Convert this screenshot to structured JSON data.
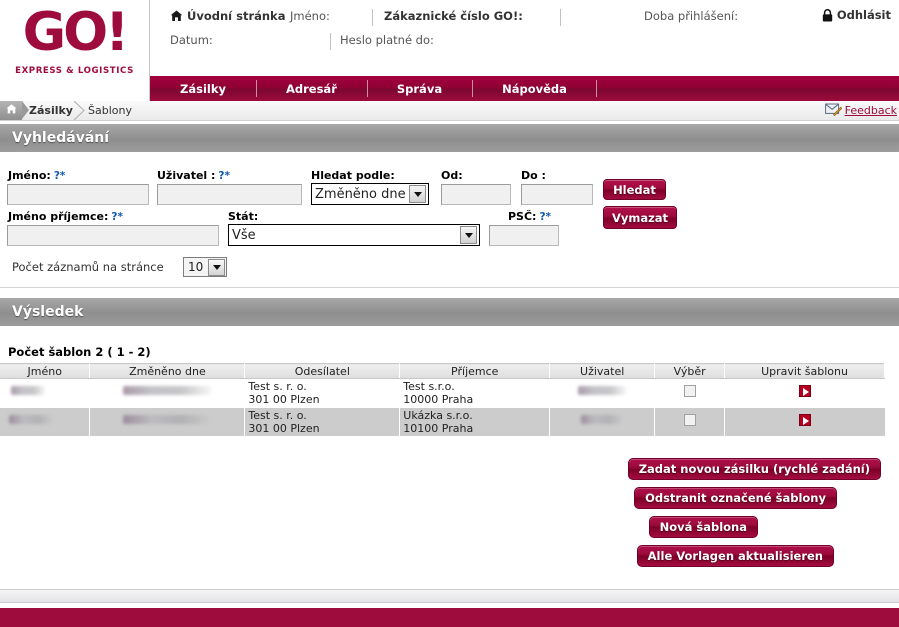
{
  "brand": {
    "logo_text": "GO!",
    "logo_sub": "EXPRESS & LOGISTICS",
    "accent_color": "#9e0b3d",
    "band_color": "#8e8e8e"
  },
  "header": {
    "home_link": "Úvodní stránka",
    "home_icon": "home-icon",
    "fields": [
      {
        "label": "Jméno:",
        "value": ""
      },
      {
        "label": "Zákaznické číslo GO!:",
        "value": ""
      },
      {
        "label": "Doba přihlášení:",
        "value": ""
      },
      {
        "label": "Datum:",
        "value": ""
      },
      {
        "label": "Heslo platné do:",
        "value": ""
      }
    ],
    "logout_label": "Odhlásit",
    "logout_icon": "lock-icon"
  },
  "nav": {
    "items": [
      {
        "label": "Zásilky"
      },
      {
        "label": "Adresář"
      },
      {
        "label": "Správa"
      },
      {
        "label": "Nápověda"
      }
    ]
  },
  "breadcrumb": {
    "home_icon": "home-icon",
    "items": [
      {
        "label": "Zásilky",
        "bold": true
      },
      {
        "label": "Šablony",
        "bold": false
      }
    ],
    "feedback_label": "Feedback",
    "feedback_icon": "envelope-pencil-icon"
  },
  "search_section": {
    "title": "Vyhledávání",
    "fields": {
      "jmeno": {
        "label": "Jméno:",
        "help": "?*",
        "value": "",
        "placeholder": ""
      },
      "uzivatel": {
        "label": "Uživatel :",
        "help": "?*",
        "value": "",
        "placeholder": ""
      },
      "hledat_podle": {
        "label": "Hledat podle:",
        "value": "Změněno dne",
        "options": [
          "Změněno dne"
        ]
      },
      "od": {
        "label": "Od:",
        "value": "",
        "placeholder": ""
      },
      "do": {
        "label": "Do :",
        "value": "",
        "placeholder": ""
      },
      "jmeno_prijemce": {
        "label": "Jméno příjemce:",
        "help": "?*",
        "value": "",
        "placeholder": ""
      },
      "stat": {
        "label": "Stát:",
        "value": "Vše",
        "options": [
          "Vše"
        ]
      },
      "psc": {
        "label": "PSČ:",
        "help": "?*",
        "value": "",
        "placeholder": ""
      }
    },
    "buttons": {
      "search": "Hledat",
      "clear": "Vymazat"
    },
    "records_per_page": {
      "label": "Počet záznamů na stránce",
      "value": "10",
      "options": [
        "10"
      ]
    }
  },
  "result_section": {
    "title": "Výsledek",
    "count_text": "Počet šablon 2 ( 1 - 2)",
    "columns": [
      "Jméno",
      "Změněno dne",
      "Odesílatel",
      "Příjemce",
      "Uživatel",
      "Výběr",
      "Upravit šablonu"
    ],
    "rows": [
      {
        "jmeno": "",
        "jmeno_redacted": true,
        "zmeneno_dne": "",
        "zmeneno_dne_redacted": true,
        "odesilatel_line1": "Test s. r. o.",
        "odesilatel_line2": "301 00  Plzen",
        "prijemce_line1": "Test s.r.o.",
        "prijemce_line2": "10000  Praha",
        "uzivatel": "",
        "uzivatel_redacted": true,
        "vyber_checked": false,
        "edit_icon": "play-icon"
      },
      {
        "jmeno": "",
        "jmeno_redacted": true,
        "zmeneno_dne": "",
        "zmeneno_dne_redacted": true,
        "odesilatel_line1": "Test s. r. o.",
        "odesilatel_line2": "301 00  Plzen",
        "prijemce_line1": "Ukázka s.r.o.",
        "prijemce_line2": "10100  Praha",
        "uzivatel": "",
        "uzivatel_redacted": true,
        "vyber_checked": false,
        "edit_icon": "play-icon"
      }
    ]
  },
  "actions": [
    {
      "label": "Zadat novou zásilku (rychlé zadání)"
    },
    {
      "label": "Odstranit označené šablony"
    },
    {
      "label": "Nová šablona"
    },
    {
      "label": "Alle Vorlagen aktualisieren"
    }
  ]
}
